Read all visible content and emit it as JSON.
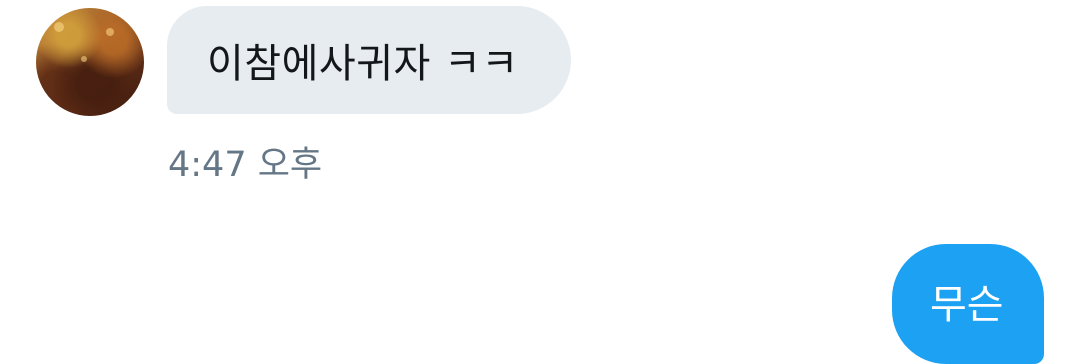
{
  "conversation": {
    "incoming": {
      "text": "이참에사귀자 ㅋㅋ",
      "timestamp": "4:47 오후"
    },
    "outgoing": {
      "text": "무슨"
    }
  },
  "colors": {
    "incoming_bubble": "#e6ecf0",
    "outgoing_bubble": "#1da1f2",
    "timestamp": "#657786",
    "text_dark": "#14171a"
  },
  "icons": {
    "avatar": "profile-photo-avatar"
  }
}
